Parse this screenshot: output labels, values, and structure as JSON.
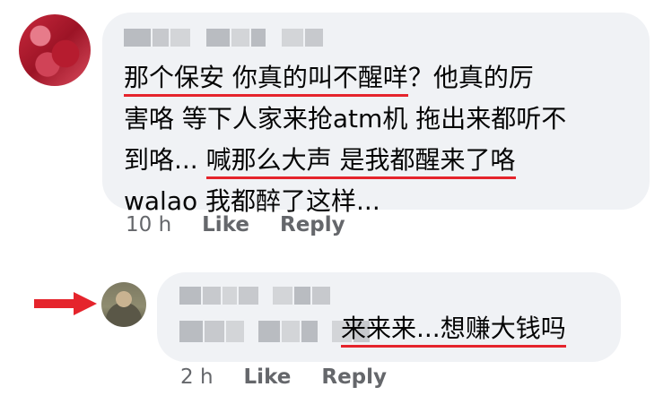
{
  "comment": {
    "lines": [
      {
        "segments": [
          {
            "text": "那个保安 你真的叫不醒咩",
            "underline": true
          },
          {
            "text": "？他真的厉",
            "underline": false
          }
        ]
      },
      {
        "segments": [
          {
            "text": "害咯 等下人家来抢atm机 拖出来都听不",
            "underline": false
          }
        ]
      },
      {
        "segments": [
          {
            "text": "到咯... ",
            "underline": false
          },
          {
            "text": "喊那么大声 是我都醒来了咯",
            "underline": true
          }
        ]
      },
      {
        "segments": [
          {
            "text": "walao 我都醉了这样...",
            "underline": false
          }
        ]
      }
    ],
    "time": "10 h",
    "like_label": "Like",
    "reply_label": "Reply"
  },
  "reply": {
    "text": "来来来...想赚大钱吗",
    "time": "2 h",
    "like_label": "Like",
    "reply_label": "Reply"
  },
  "colors": {
    "bubble": "#f0f2f5",
    "text": "#050505",
    "meta": "#65676b",
    "highlight": "#e5242c"
  },
  "icons": {
    "arrow": "red-arrow-right-icon"
  }
}
